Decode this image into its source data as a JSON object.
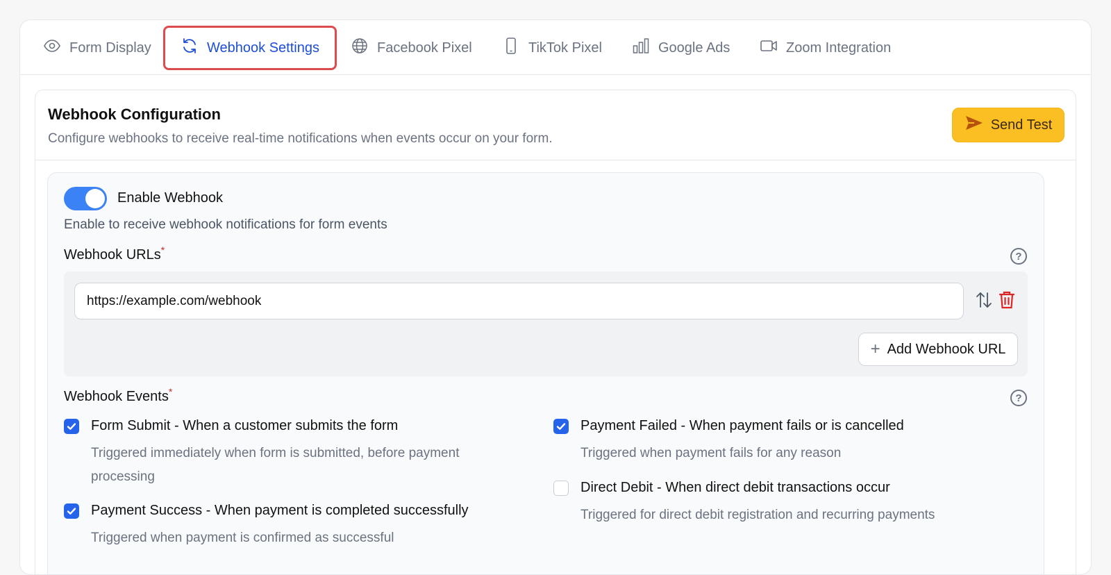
{
  "tabs": [
    {
      "label": "Form Display",
      "icon": "eye-icon"
    },
    {
      "label": "Webhook Settings",
      "icon": "refresh-icon",
      "active": true
    },
    {
      "label": "Facebook Pixel",
      "icon": "globe-icon"
    },
    {
      "label": "TikTok Pixel",
      "icon": "phone-icon"
    },
    {
      "label": "Google Ads",
      "icon": "bar-chart-icon"
    },
    {
      "label": "Zoom Integration",
      "icon": "video-icon"
    }
  ],
  "card": {
    "title": "Webhook Configuration",
    "subtitle": "Configure webhooks to receive real-time notifications when events occur on your form.",
    "send_test_label": "Send Test"
  },
  "enable": {
    "label": "Enable Webhook",
    "description": "Enable to receive webhook notifications for form events",
    "enabled": true
  },
  "urls": {
    "label": "Webhook URLs",
    "required_mark": "*",
    "values": [
      "https://example.com/webhook"
    ],
    "add_label": "Add Webhook URL"
  },
  "events": {
    "label": "Webhook Events",
    "required_mark": "*",
    "items": [
      {
        "title": "Form Submit - When a customer submits the form",
        "description": "Triggered immediately when form is submitted, before payment processing",
        "checked": true
      },
      {
        "title": "Payment Success - When payment is completed successfully",
        "description": "Triggered when payment is confirmed as successful",
        "checked": true
      },
      {
        "title": "Payment Failed - When payment fails or is cancelled",
        "description": "Triggered when payment fails for any reason",
        "checked": true
      },
      {
        "title": "Direct Debit - When direct debit transactions occur",
        "description": "Triggered for direct debit registration and recurring payments",
        "checked": false
      }
    ]
  },
  "colors": {
    "accent": "#2563eb",
    "active_tab_text": "#1d4ed8",
    "active_tab_border": "#dc4c4f",
    "send_button": "#fbbf24",
    "delete": "#dc2626"
  }
}
